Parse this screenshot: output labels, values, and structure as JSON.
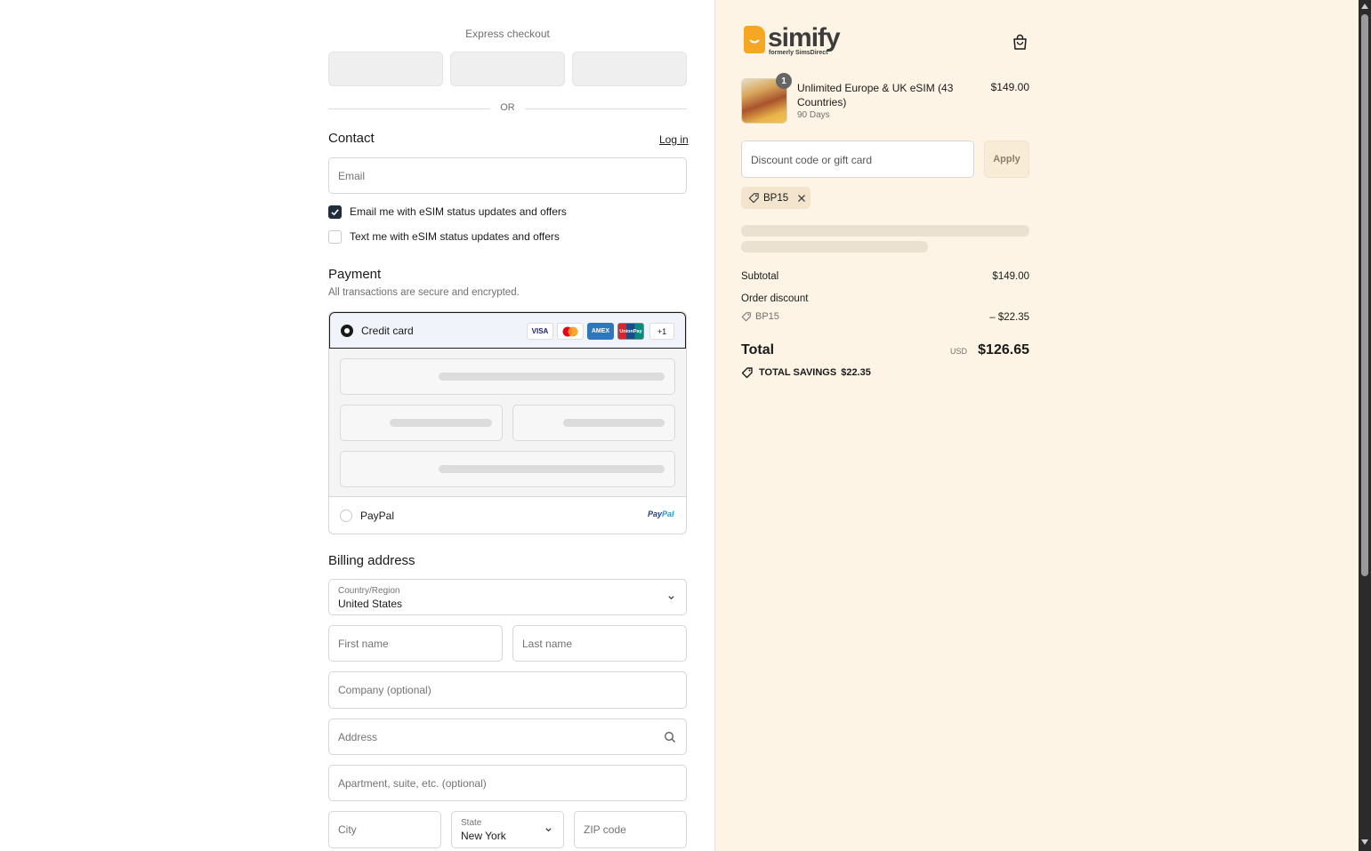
{
  "express": {
    "title": "Express checkout",
    "or": "OR"
  },
  "contact": {
    "title": "Contact",
    "login": "Log in",
    "email_placeholder": "Email",
    "opt_email": {
      "label": "Email me with eSIM status updates and offers",
      "checked": true
    },
    "opt_text": {
      "label": "Text me with eSIM status updates and offers",
      "checked": false
    }
  },
  "payment": {
    "title": "Payment",
    "subtitle": "All transactions are secure and encrypted.",
    "credit_card_label": "Credit card",
    "card_brands": [
      "VISA",
      "Mastercard",
      "AMEX",
      "UnionPay"
    ],
    "more_cards": "+1",
    "paypal_label": "PayPal",
    "paypal_logo_a": "Pay",
    "paypal_logo_b": "Pal"
  },
  "billing": {
    "title": "Billing address",
    "country_label": "Country/Region",
    "country_value": "United States",
    "first_name": "First name",
    "last_name": "Last name",
    "company": "Company (optional)",
    "address": "Address",
    "apartment": "Apartment, suite, etc. (optional)",
    "city": "City",
    "state_label": "State",
    "state_value": "New York",
    "zip": "ZIP code"
  },
  "brand": {
    "name": "simify",
    "tagline": "formerly SimsDirect",
    "accent": "#f5a623"
  },
  "order": {
    "item": {
      "name": "Unlimited Europe & UK eSIM (43 Countries)",
      "variant": "90 Days",
      "price": "$149.00",
      "quantity": "1"
    },
    "discount_placeholder": "Discount code or gift card",
    "apply": "Apply",
    "applied_code": "BP15",
    "subtotal_label": "Subtotal",
    "subtotal": "$149.00",
    "order_discount_label": "Order discount",
    "discount_code": "BP15",
    "discount_amount": "– $22.35",
    "total_label": "Total",
    "currency": "USD",
    "total": "$126.65",
    "savings_label": "TOTAL SAVINGS",
    "savings_amount": "$22.35"
  }
}
